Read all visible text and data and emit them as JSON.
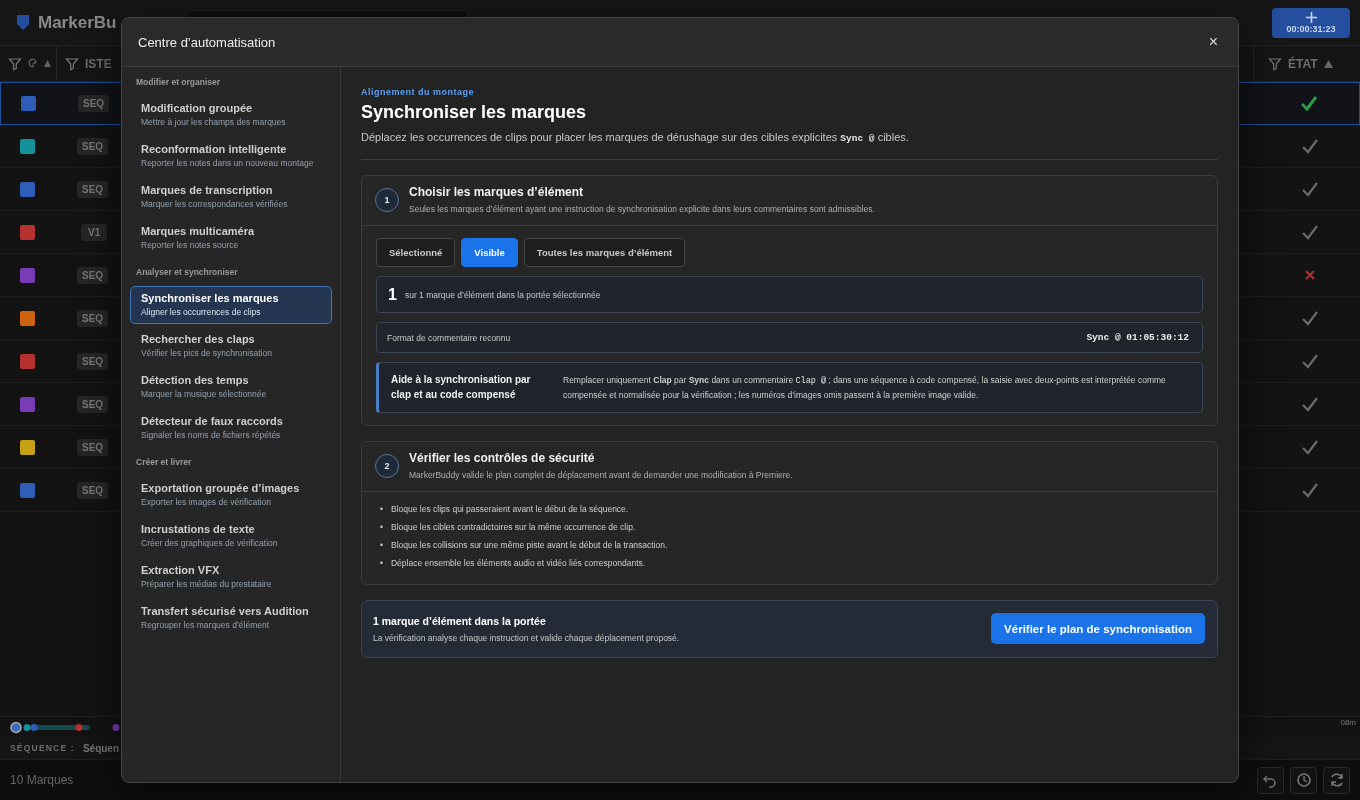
{
  "app": {
    "logo": "MarkerBu",
    "add_button": {
      "time": "00:00:31:23"
    },
    "columns": [
      {
        "label": "ISTE"
      },
      {
        "label": "ÉTAT"
      }
    ],
    "rows": [
      {
        "color": "#2f5db8",
        "type": "SEQ",
        "passed": true,
        "selected": true
      },
      {
        "color": "#15919c",
        "type": "SEQ",
        "passed": true,
        "selected": false
      },
      {
        "color": "#2f5db8",
        "type": "SEQ",
        "passed": true,
        "selected": false
      },
      {
        "color": "#b73131",
        "type": "V1",
        "passed": true,
        "selected": false
      },
      {
        "color": "#7a3cb6",
        "type": "SEQ",
        "passed": false,
        "selected": false
      },
      {
        "color": "#cf620f",
        "type": "SEQ",
        "passed": true,
        "selected": false
      },
      {
        "color": "#b73131",
        "type": "SEQ",
        "passed": true,
        "selected": false
      },
      {
        "color": "#7a3cb6",
        "type": "SEQ",
        "passed": true,
        "selected": false
      },
      {
        "color": "#c79f16",
        "type": "SEQ",
        "passed": true,
        "selected": false
      },
      {
        "color": "#2f5db8",
        "type": "SEQ",
        "passed": true,
        "selected": false
      }
    ],
    "timeline_end": "08m",
    "sequence_label": "SÉQUENCE :",
    "sequence_value": "Séquen",
    "marker_count": "10 Marques"
  },
  "dialog": {
    "title": "Centre d’automatisation",
    "close": "×",
    "sidebar": [
      {
        "heading": "Modifier et organiser",
        "items": [
          {
            "title": "Modification groupée",
            "subtitle": "Mettre à jour les champs des marques",
            "selected": false
          },
          {
            "title": "Reconformation intelligente",
            "subtitle": "Reporter les notes dans un nouveau montage",
            "selected": false
          },
          {
            "title": "Marques de transcription",
            "subtitle": "Marquer les correspondances vérifiées",
            "selected": false
          },
          {
            "title": "Marques multicaméra",
            "subtitle": "Reporter les notes source",
            "selected": false
          }
        ]
      },
      {
        "heading": "Analyser et synchroniser",
        "items": [
          {
            "title": "Synchroniser les marques",
            "subtitle": "Aligner les occurrences de clips",
            "selected": true
          },
          {
            "title": "Rechercher des claps",
            "subtitle": "Vérifier les pics de synchronisation",
            "selected": false
          },
          {
            "title": "Détection des temps",
            "subtitle": "Marquer la musique sélectionnée",
            "selected": false
          },
          {
            "title": "Détecteur de faux raccords",
            "subtitle": "Signaler les noms de fichiers répétés",
            "selected": false
          }
        ]
      },
      {
        "heading": "Créer et livrer",
        "items": [
          {
            "title": "Exportation groupée d’images",
            "subtitle": "Exporter les images de vérification",
            "selected": false
          },
          {
            "title": "Incrustations de texte",
            "subtitle": "Créer des graphiques de vérification",
            "selected": false
          },
          {
            "title": "Extraction VFX",
            "subtitle": "Préparer les médias du prestataire",
            "selected": false
          },
          {
            "title": "Transfert sécurisé vers Audition",
            "subtitle": "Regrouper les marques d’élément",
            "selected": false
          }
        ]
      }
    ],
    "eyebrow": "Alignement du montage",
    "heading": "Synchroniser les marques",
    "description": [
      {
        "kind": "plain",
        "text": "Déplacez les occurrences de clips pour placer les marques de dérushage sur des cibles explicites "
      },
      {
        "kind": "code",
        "text": "Sync @"
      },
      {
        "kind": "plain",
        "text": " cibles."
      }
    ],
    "step1": {
      "number": "1",
      "title": "Choisir les marques d’élément",
      "subtitle": "Seules les marques d’élément ayant une instruction de synchronisation explicite dans leurs commentaires sont admissibles.",
      "scopes": [
        {
          "label": "Sélectionné",
          "selected": false
        },
        {
          "label": "Visible",
          "selected": true
        },
        {
          "label": "Toutes les marques d’élément",
          "selected": false
        }
      ],
      "count": "1",
      "count_text": "sur 1 marque d’élément dans la portée sélectionnée",
      "format_label": "Format de commentaire reconnu",
      "format_value": "Sync @ 01:05:30:12",
      "help_title": "Aide à la synchronisation par clap et au code compensé",
      "help_text": [
        {
          "kind": "plain",
          "text": "Remplacer uniquement "
        },
        {
          "kind": "bold",
          "text": "Clap"
        },
        {
          "kind": "plain",
          "text": " par "
        },
        {
          "kind": "bold",
          "text": "Sync"
        },
        {
          "kind": "plain",
          "text": " dans un commentaire "
        },
        {
          "kind": "code",
          "text": "Clap @"
        },
        {
          "kind": "plain",
          "text": " ; dans une séquence à code compensé, la saisie avec deux-points est interprétée comme compensée et normalisée pour la vérification ; les numéros d’images omis passent à la première image valide."
        }
      ]
    },
    "step2": {
      "number": "2",
      "title": "Vérifier les contrôles de sécurité",
      "subtitle": "MarkerBuddy valide le plan complet de déplacement avant de demander une modification à Premiere.",
      "bullet": "•",
      "checks": [
        "Bloque les clips qui passeraient avant le début de la séquence.",
        "Bloque les cibles contradictoires sur la même occurrence de clip.",
        "Bloque les collisions sur une même piste avant le début de la transaction.",
        "Déplace ensemble les éléments audio et vidéo liés correspondants."
      ]
    },
    "footer": {
      "title": "1 marque d’élément dans la portée",
      "subtitle": "La vérification analyse chaque instruction et valide chaque déplacement proposé.",
      "button": "Vérifier le plan de synchronisation"
    }
  }
}
